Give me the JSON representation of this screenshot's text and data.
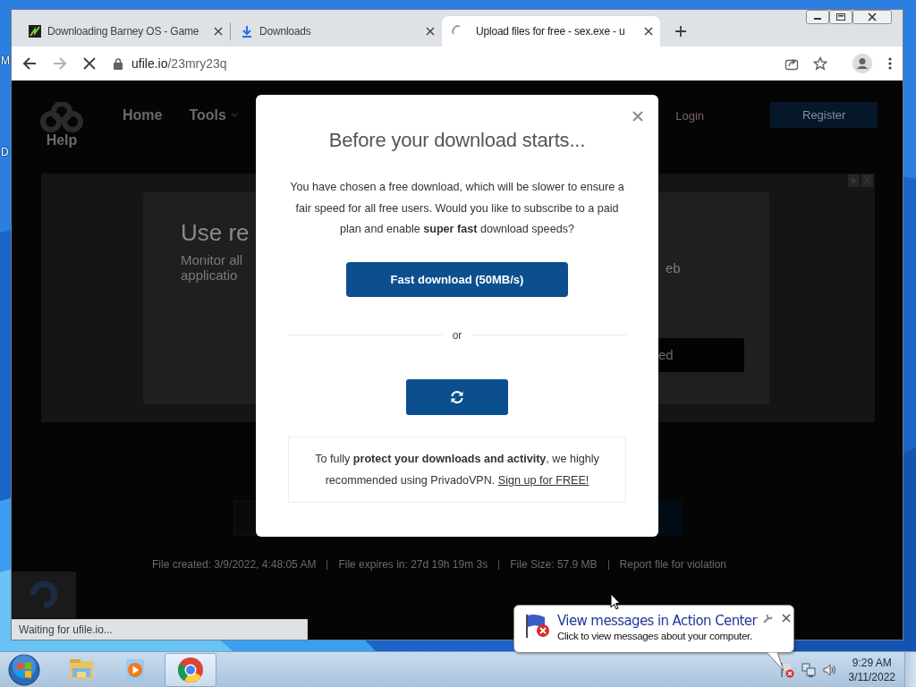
{
  "desktop": {
    "icon_labels": [
      "M",
      "D"
    ]
  },
  "browser": {
    "tabs": [
      {
        "title": "Downloading Barney OS - Game",
        "kind": "game",
        "selected": false
      },
      {
        "title": "Downloads",
        "kind": "download",
        "selected": false
      },
      {
        "title": "Upload files for free - sex.exe - u",
        "kind": "loading",
        "selected": true
      }
    ],
    "address": {
      "host": "ufile.io",
      "path": "/23mry23q"
    },
    "status": "Waiting for ufile.io..."
  },
  "page": {
    "nav": {
      "logo_caption": "Help",
      "links": [
        "Home",
        "Tools"
      ],
      "login": "Login",
      "register": "Register"
    },
    "ad": {
      "headline": "Use re",
      "lines": [
        "Monitor all",
        "applicatio"
      ],
      "text_fragment": "eb",
      "button_fragment": "ed"
    },
    "file_info": [
      "File created: 3/9/2022, 4:48:05 AM",
      "File expires in: 27d 19h 19m 3s",
      "File Size: 57.9 MB",
      "Report file for violation"
    ]
  },
  "modal": {
    "title": "Before your download starts...",
    "message": "You have chosen a free download, which will be slower to ensure a fair speed for all free users. Would you like to subscribe to a paid plan and enable **super fast** download speeds?",
    "primary_button": "Fast download (50MB/s)",
    "divider": "or",
    "notice": "To fully **protect your downloads and activity**, we highly recommended using PrivadoVPN.",
    "notice_link": "Sign up for FREE!"
  },
  "taskbar": {
    "apps": [
      {
        "kind": "explorer",
        "selected": false
      },
      {
        "kind": "media",
        "selected": false
      },
      {
        "kind": "chrome",
        "selected": true
      }
    ],
    "time": "9:29 AM",
    "date": "3/11/2022"
  },
  "balloon": {
    "title": "View messages in Action Center",
    "body": "Click to view messages about your computer."
  }
}
